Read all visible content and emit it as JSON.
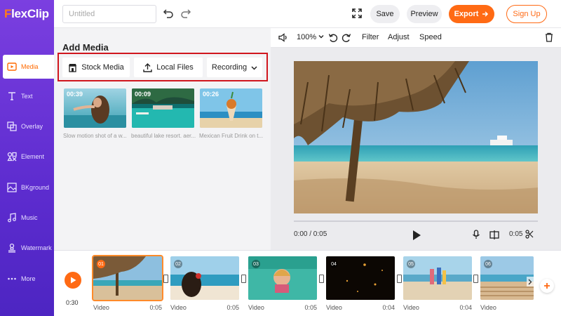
{
  "app": {
    "logo_prefix": "F",
    "logo_rest": "lexClip"
  },
  "topbar": {
    "title_placeholder": "Untitled",
    "undo_icon": "undo-icon",
    "redo_icon": "redo-icon",
    "fullscreen_icon": "fullscreen-icon",
    "save_label": "Save",
    "preview_label": "Preview",
    "export_label": "Export",
    "signup_label": "Sign Up"
  },
  "sidebar": {
    "items": [
      {
        "label": "Media",
        "icon": "media-icon",
        "active": true
      },
      {
        "label": "Text",
        "icon": "text-icon"
      },
      {
        "label": "Overlay",
        "icon": "overlay-icon"
      },
      {
        "label": "Element",
        "icon": "element-icon"
      },
      {
        "label": "BKground",
        "icon": "background-icon"
      },
      {
        "label": "Music",
        "icon": "music-icon"
      },
      {
        "label": "Watermark",
        "icon": "watermark-icon"
      },
      {
        "label": "More",
        "icon": "more-icon"
      }
    ]
  },
  "media_panel": {
    "title": "Add Media",
    "sources": [
      {
        "label": "Stock Media",
        "icon": "store-icon"
      },
      {
        "label": "Local Files",
        "icon": "upload-icon"
      },
      {
        "label": "Recording",
        "icon": "chevron-down-icon"
      }
    ],
    "items": [
      {
        "duration": "00:39",
        "caption": "Slow motion shot of a w..."
      },
      {
        "duration": "00:09",
        "caption": "beautiful lake resort. aer..."
      },
      {
        "duration": "00:26",
        "caption": "Mexican Fruit Drink on t..."
      }
    ]
  },
  "editor": {
    "volume_icon": "volume-icon",
    "zoom": "100%",
    "rotate_left_icon": "rotate-left-icon",
    "rotate_right_icon": "rotate-right-icon",
    "filter_label": "Filter",
    "adjust_label": "Adjust",
    "speed_label": "Speed",
    "delete_icon": "trash-icon",
    "current_time": "0:00 / 0:05",
    "end_time": "0:05",
    "progress": 0
  },
  "timeline": {
    "total": "0:30",
    "clips": [
      {
        "num": "01",
        "label": "Video",
        "duration": "0:05"
      },
      {
        "num": "02",
        "label": "Video",
        "duration": "0:05"
      },
      {
        "num": "03",
        "label": "Video",
        "duration": "0:05"
      },
      {
        "num": "04",
        "label": "Video",
        "duration": "0:04"
      },
      {
        "num": "05",
        "label": "Video",
        "duration": "0:04"
      },
      {
        "num": "06",
        "label": "Video",
        "duration": ""
      }
    ]
  },
  "colors": {
    "accent": "#ff6a14",
    "sidebar": "#6a35d8",
    "highlight_box": "#d0161e"
  }
}
